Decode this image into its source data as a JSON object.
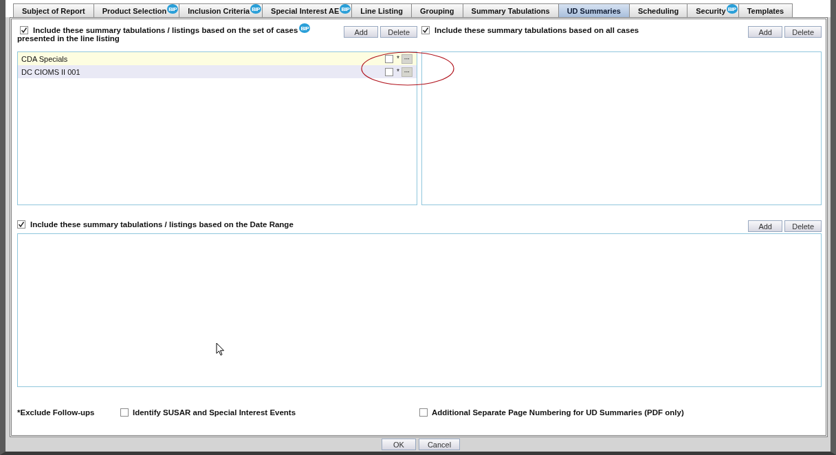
{
  "tabs": [
    {
      "label": "Subject of Report",
      "selected": false
    },
    {
      "label": "Product Selection",
      "selected": false,
      "badge": "BIP"
    },
    {
      "label": "Inclusion Criteria",
      "selected": false,
      "badge": "BIP"
    },
    {
      "label": "Special Interest AE",
      "selected": false,
      "badge": "BIP"
    },
    {
      "label": "Line Listing",
      "selected": false
    },
    {
      "label": "Grouping",
      "selected": false
    },
    {
      "label": "Summary Tabulations",
      "selected": false
    },
    {
      "label": "UD Summaries",
      "selected": true
    },
    {
      "label": "Scheduling",
      "selected": false
    },
    {
      "label": "Security",
      "selected": false,
      "badge": "BIP"
    },
    {
      "label": "Templates",
      "selected": false
    }
  ],
  "sections": [
    {
      "checked": true,
      "title": "Include these summary tabulations / listings based on the set of cases",
      "badge": "BIP",
      "subtitle": "presented in the line listing",
      "buttons": [
        "Add",
        "Delete"
      ],
      "rows": [
        {
          "name": "CDA Specials",
          "selected": true,
          "checked": false,
          "marker": "*",
          "button": "···"
        },
        {
          "name": "DC CIOMS II 001",
          "selected": false,
          "checked": false,
          "marker": "*",
          "button": "···"
        }
      ]
    },
    {
      "checked": true,
      "title": "Include these summary tabulations based on all cases",
      "buttons": [
        "Add",
        "Delete"
      ]
    },
    {
      "checked": true,
      "title": "Include these summary tabulations / listings based on the Date Range",
      "buttons": [
        "Add",
        "Delete"
      ]
    }
  ],
  "options": [
    {
      "kind": "label",
      "label": "*Exclude Follow-ups"
    },
    {
      "kind": "checkbox",
      "label": "Identify SUSAR and Special Interest Events",
      "checked": false
    },
    {
      "kind": "checkbox",
      "label": "Additional Separate Page Numbering for UD Summaries (PDF only)",
      "checked": false
    }
  ],
  "dialog_buttons": [
    "OK",
    "Cancel"
  ]
}
